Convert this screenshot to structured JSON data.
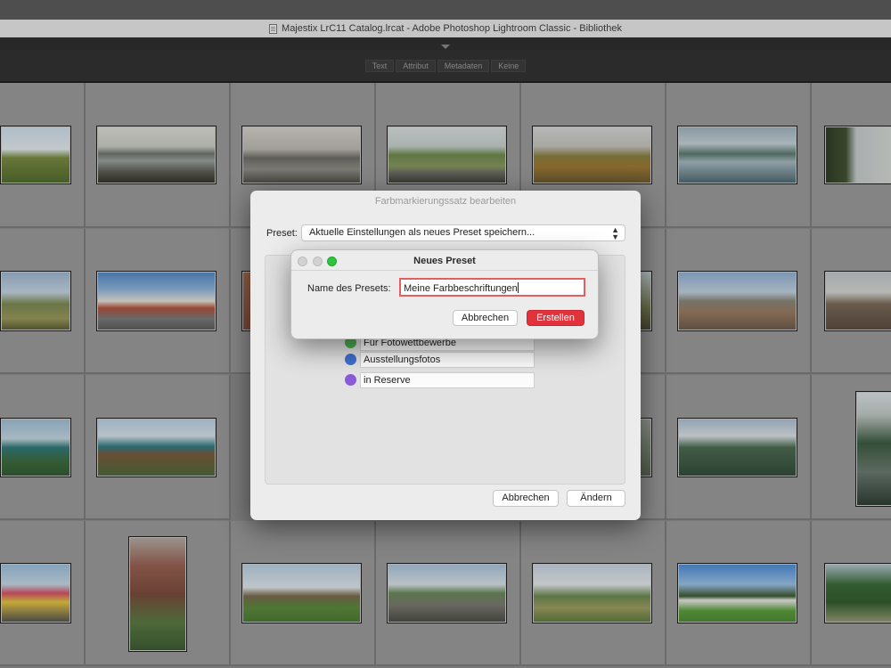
{
  "window": {
    "title": "Majestix LrC11 Catalog.lrcat - Adobe Photoshop Lightroom Classic - Bibliothek"
  },
  "filter_bar": {
    "items": [
      "Text",
      "Attribut",
      "Metadaten",
      "Keine"
    ]
  },
  "grid": {
    "thumbnails": [
      "landscape-field",
      "lake-shore",
      "lake-trees-bw",
      "stone-wall-hills",
      "heath-flowers",
      "harbor-boats",
      "river-tree",
      "coast-fields",
      "village-street",
      "ruin-wall",
      "standing-stones",
      "boulder-moor",
      "sea-coast",
      "sea-stack",
      "green-hills",
      "waterfall-rocks",
      "colorful-houses",
      "castle-tower",
      "castle-field",
      "stone-wall-fields",
      "meadow",
      "manor-house",
      "park-trees"
    ]
  },
  "sheet": {
    "title": "Farbmarkierungssatz bearbeiten",
    "preset_label": "Preset:",
    "preset_value": "Aktuelle Einstellungen als neues Preset speichern...",
    "labels": [
      {
        "text": "Für Fotowettbewerbe",
        "color": "#4caf50"
      },
      {
        "text": "Ausstellungsfotos",
        "color": "#3f6fd1"
      },
      {
        "text": "in Reserve",
        "color": "#8a5ad8"
      }
    ],
    "cancel_label": "Abbrechen",
    "change_label": "Ändern"
  },
  "dialog": {
    "title": "Neues Preset",
    "name_label": "Name des Presets:",
    "name_value": "Meine Farbbeschriftungen",
    "cancel_label": "Abbrechen",
    "create_label": "Erstellen",
    "accent_color": "#e2323b"
  }
}
